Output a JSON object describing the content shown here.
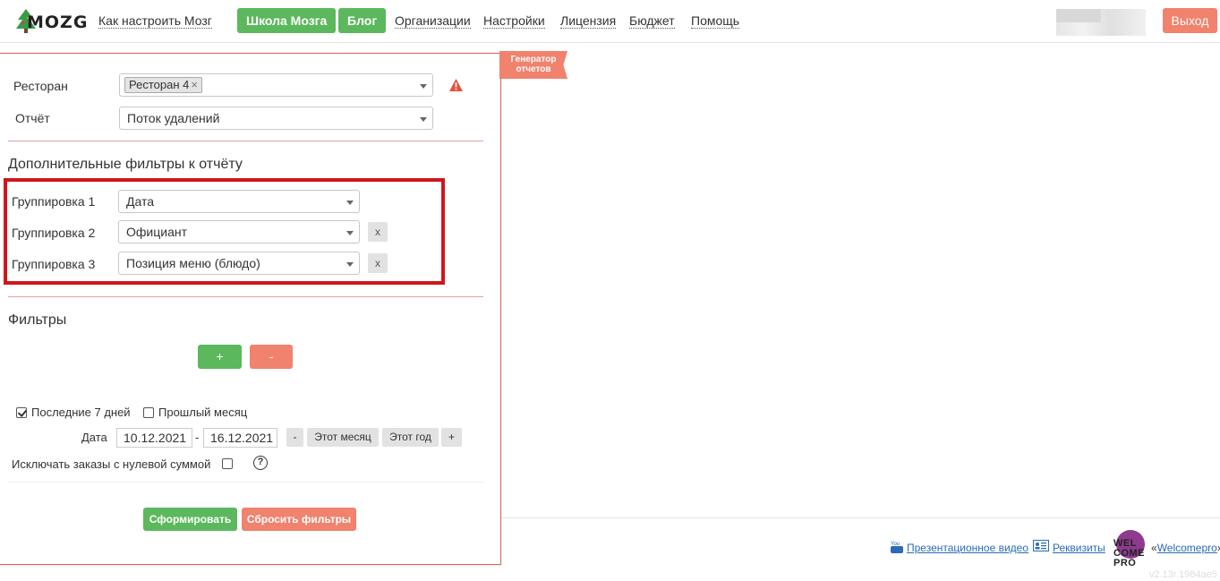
{
  "nav": {
    "logo": "MOZG",
    "how_to": "Как настроить Мозг",
    "school": "Школа Мозга",
    "blog": "Блог",
    "orgs": "Организации",
    "settings": "Настройки",
    "license": "Лицензия",
    "budget": "Бюджет",
    "help": "Помощь",
    "logout": "Выход"
  },
  "panel": {
    "tab_line1": "Генератор",
    "tab_line2": "отчетов",
    "restaurant_label": "Ресторан",
    "restaurant_tag": "Ресторан 4",
    "restaurant_tag_remove": "×",
    "report_label": "Отчёт",
    "report_value": "Поток удалений",
    "extra_filters_title": "Дополнительные фильтры к отчёту",
    "groupings": [
      {
        "label": "Группировка 1",
        "value": "Дата"
      },
      {
        "label": "Группировка 2",
        "value": "Официант",
        "remove": "x"
      },
      {
        "label": "Группировка 3",
        "value": "Позиция меню (блюдо)",
        "remove": "x"
      }
    ],
    "filters_title": "Фильтры",
    "add_filter": "+",
    "remove_filter": "-",
    "last7_label": "Последние 7 дней",
    "last7_checked": true,
    "prev_month_label": "Прошлый месяц",
    "prev_month_checked": false,
    "date_label": "Дата",
    "date_from": "10.12.2021",
    "date_sep": "-",
    "date_to": "16.12.2021",
    "date_prev": "-",
    "this_month": "Этот месяц",
    "this_year": "Этот год",
    "date_next": "+",
    "exclude_zero_label": "Исключать заказы с нулевой суммой",
    "exclude_zero_checked": false,
    "help_icon": "?",
    "submit": "Сформировать",
    "reset": "Сбросить фильтры"
  },
  "footer": {
    "video": "Презентационное видео",
    "requisites": "Реквизиты",
    "wc_prefix": "«",
    "wc_link": "Welcomepro",
    "wc_suffix": "»",
    "wc_logo_lines": [
      "WEL",
      "COME",
      "PRO"
    ],
    "version": "v2.13r.1984ae5"
  },
  "colors": {
    "green": "#5cb85c",
    "salmon": "#f0826e",
    "highlight_red": "#d0161c",
    "link_blue": "#2a6bb8"
  }
}
